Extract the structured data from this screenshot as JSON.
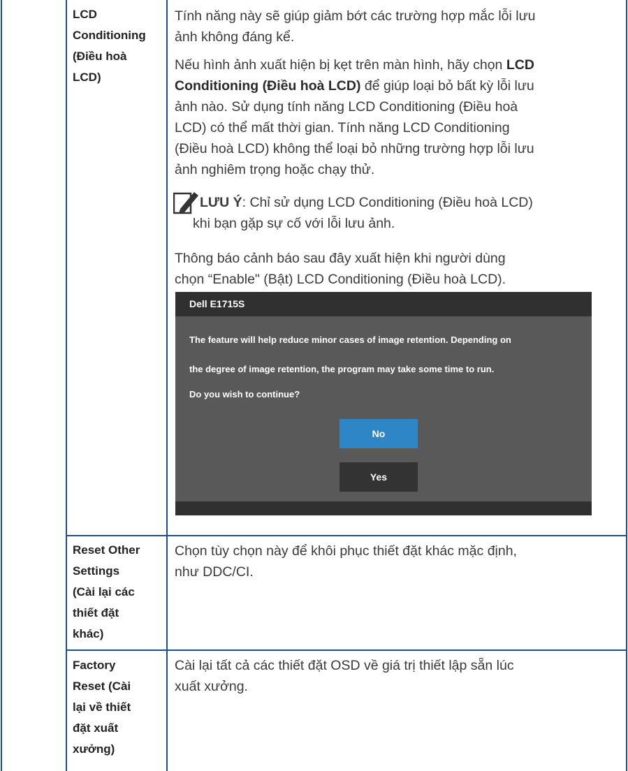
{
  "rows": [
    {
      "label_lines": [
        "LCD",
        "Conditioning",
        "(Điều hoà",
        "LCD)"
      ],
      "intro_lines": [
        "Tính năng này sẽ giúp giảm bớt các trường hợp mắc lỗi lưu",
        "ảnh không đáng kể."
      ],
      "p2_line1_pre": "Nếu hình ảnh xuất hiện bị kẹt trên màn hình, hãy chọn ",
      "p2_line1_bold": "LCD",
      "p2_line2_bold": "Conditioning (Điều hoà LCD)",
      "p2_line2_post": " để giúp loại bỏ bất kỳ lỗi lưu",
      "p2_lines_rest": [
        "ảnh nào. Sử dụng tính năng LCD Conditioning (Điều hoà",
        "LCD) có thể mất thời gian. Tính năng LCD Conditioning",
        "(Điều hoà LCD) không thể loại bỏ những trường hợp lỗi lưu",
        "ảnh nghiêm trọng hoặc chạy thử."
      ],
      "note_label": "LƯU Ý",
      "note_line1": ": Chỉ sử dụng LCD Conditioning (Điều hoà LCD)",
      "note_line2": "khi bạn gặp sự cố với lỗi lưu ảnh.",
      "warning_lines": [
        "Thông báo cảnh báo sau đây xuất hiện khi người dùng",
        "chọn “Enable\" (Bật) LCD Conditioning (Điều hoà LCD)."
      ],
      "osd": {
        "title": "Dell E1715S",
        "message_lines": [
          "The feature will help reduce minor cases of image retention. Depending on",
          "the degree of image retention, the program may take some time to run.",
          "Do you wish to continue?"
        ],
        "no_label": "No",
        "yes_label": "Yes"
      }
    },
    {
      "label_lines": [
        "Reset Other",
        "Settings",
        "(Cài lại các",
        "thiết đặt",
        "khác)"
      ],
      "desc_lines": [
        "Chọn tùy chọn này để khôi phục thiết đặt khác mặc định,",
        "như DDC/CI."
      ]
    },
    {
      "label_lines": [
        "Factory",
        "Reset (Cài",
        "lại về thiết",
        "đặt xuất",
        "xưởng)"
      ],
      "desc_lines": [
        "Cài lại tất cả các thiết đặt OSD về giá trị thiết lập sẵn lúc",
        "xuất xưởng."
      ]
    }
  ],
  "colors": {
    "border": "#1a4f8a",
    "osd_body": "#595959",
    "osd_bar": "#303030",
    "no_button": "#2f86c6",
    "yes_button": "#333333"
  },
  "icons": [
    "note-pencil-icon"
  ]
}
